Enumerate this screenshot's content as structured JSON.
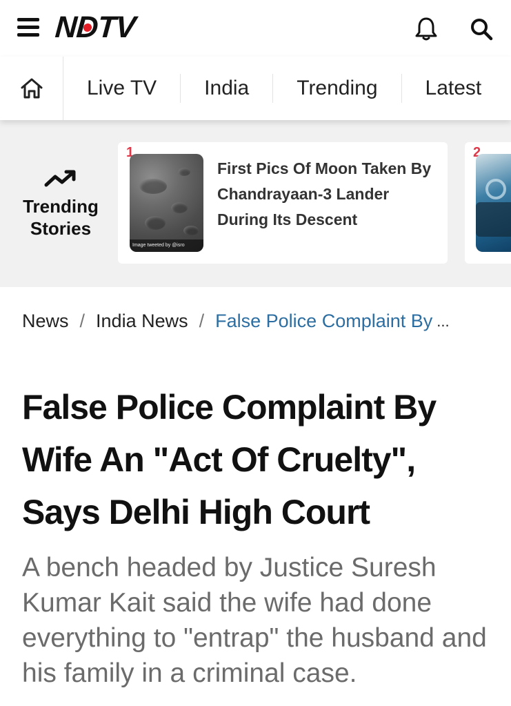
{
  "header": {
    "logo_text": "NDTV",
    "menu_icon": "hamburger-menu-icon",
    "notification_icon": "bell-icon",
    "search_icon": "search-icon",
    "brand_color": "#e41e26"
  },
  "nav": {
    "home_icon": "home-icon",
    "tabs": [
      {
        "label": "Live TV"
      },
      {
        "label": "India"
      },
      {
        "label": "Trending"
      },
      {
        "label": "Latest"
      }
    ]
  },
  "trending": {
    "icon": "trending-up-arrow-icon",
    "label": "Trending Stories",
    "cards": [
      {
        "rank": "1",
        "image_caption": "Image tweeted by @isro",
        "headline": "First Pics Of Moon Taken By Chandrayaan-3 Lander During Its Descent"
      },
      {
        "rank": "2"
      }
    ],
    "rank_color": "#e0394a"
  },
  "breadcrumb": {
    "items": [
      "News",
      "India News"
    ],
    "current": "False Police Complaint By",
    "ellipsis": "...",
    "separator": "/",
    "link_color": "#2c6ea1"
  },
  "article": {
    "title": "False Police Complaint By Wife An \"Act Of Cruelty\", Says Delhi High Court",
    "summary": "A bench headed by Justice Suresh Kumar Kait said the wife had done everything to \"entrap\" the husband and his family in a criminal case."
  }
}
